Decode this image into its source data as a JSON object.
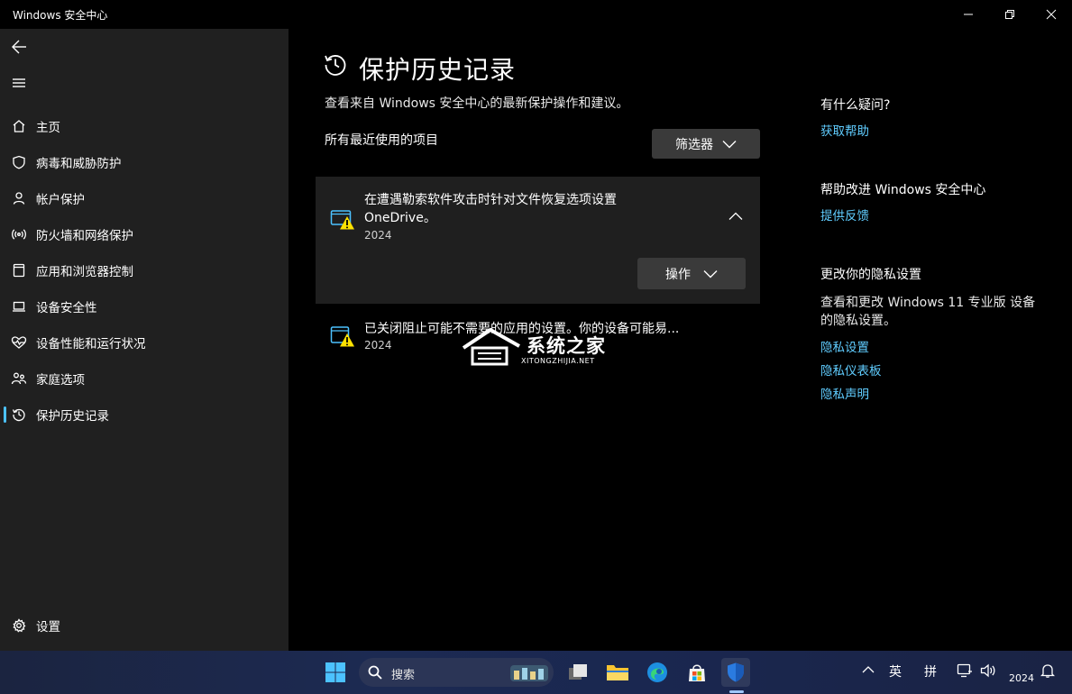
{
  "window": {
    "title": "Windows 安全中心"
  },
  "sidebar": {
    "items": [
      {
        "label": "主页",
        "icon": "home-icon"
      },
      {
        "label": "病毒和威胁防护",
        "icon": "shield-icon"
      },
      {
        "label": "帐户保护",
        "icon": "person-icon"
      },
      {
        "label": "防火墙和网络保护",
        "icon": "wireless-icon"
      },
      {
        "label": "应用和浏览器控制",
        "icon": "app-window-icon"
      },
      {
        "label": "设备安全性",
        "icon": "laptop-icon"
      },
      {
        "label": "设备性能和运行状况",
        "icon": "heart-pulse-icon"
      },
      {
        "label": "家庭选项",
        "icon": "family-icon"
      },
      {
        "label": "保护历史记录",
        "icon": "history-icon",
        "active": true
      }
    ],
    "settings_label": "设置"
  },
  "main": {
    "title": "保护历史记录",
    "subtitle": "查看来自 Windows 安全中心的最新保护操作和建议。",
    "section_label": "所有最近使用的项目",
    "filter_label": "筛选器",
    "items": [
      {
        "title": "在遭遇勒索软件攻击时针对文件恢复选项设置 OneDrive。",
        "date": "2024",
        "action_label": "操作",
        "expanded": true
      },
      {
        "title": "已关闭阻止可能不需要的应用的设置。你的设备可能易...",
        "date": "2024",
        "expanded": false
      }
    ]
  },
  "rail": {
    "help_heading": "有什么疑问?",
    "help_link": "获取帮助",
    "improve_heading": "帮助改进 Windows 安全中心",
    "feedback_link": "提供反馈",
    "privacy_heading": "更改你的隐私设置",
    "privacy_text": "查看和更改 Windows 11 专业版 设备的隐私设置。",
    "privacy_links": [
      "隐私设置",
      "隐私仪表板",
      "隐私声明"
    ]
  },
  "watermark": {
    "text": "系统之家",
    "sub": "XITONGZHIJIA.NET"
  },
  "taskbar": {
    "search_placeholder": "搜索",
    "ime_lang": "英",
    "ime_mode": "拼",
    "clock": "2024"
  },
  "colors": {
    "accent": "#4cc2ff",
    "link": "#60cdff",
    "warning": "#fce100",
    "sidebar_bg": "#202020",
    "card_bg": "#1f1f1f"
  }
}
